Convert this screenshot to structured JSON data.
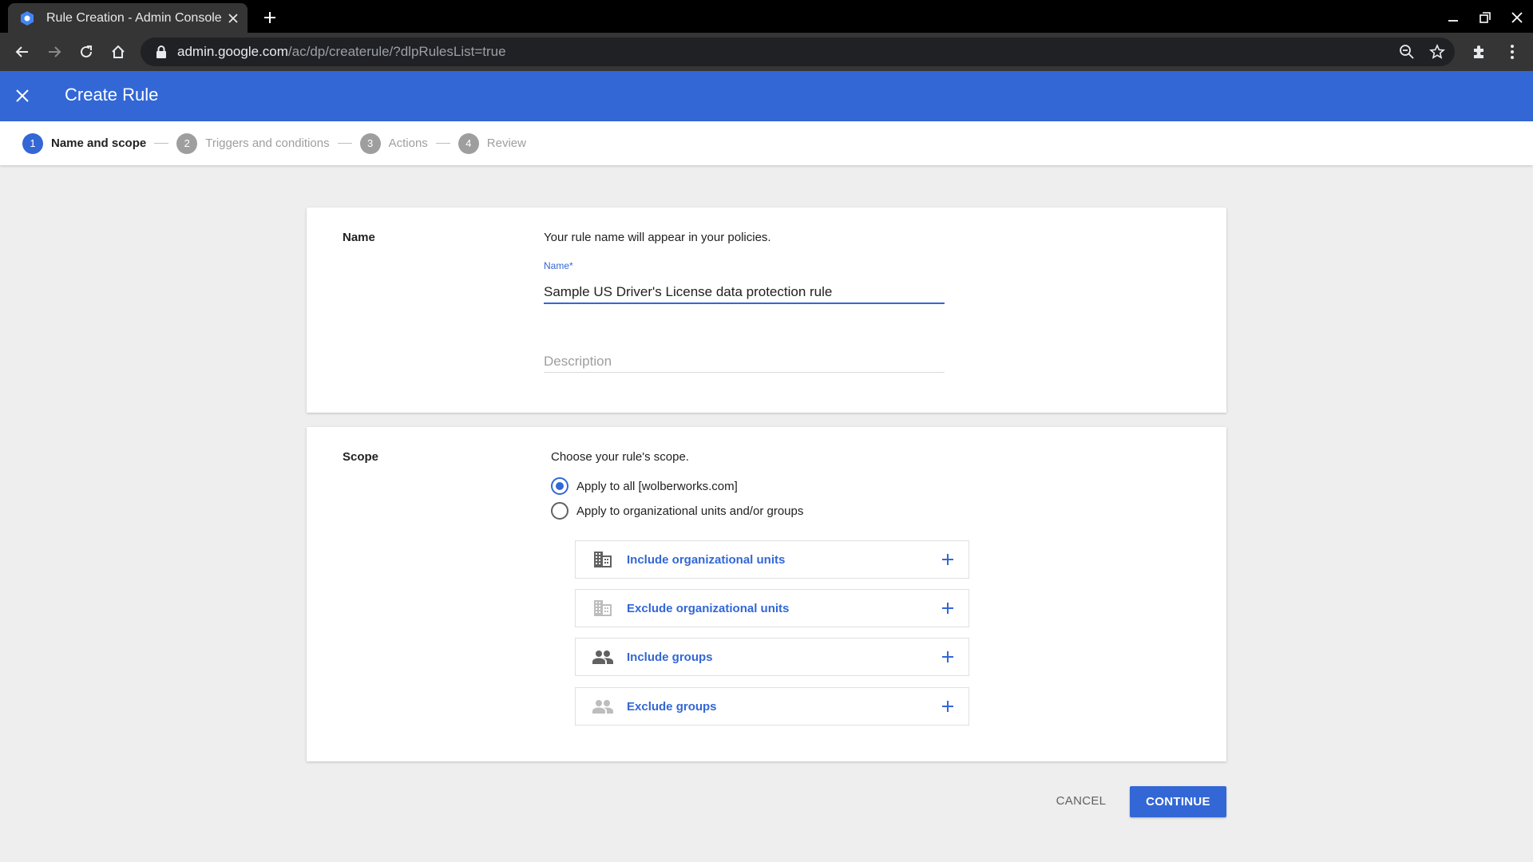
{
  "browser": {
    "tab_title": "Rule Creation - Admin Console",
    "url_host": "admin.google.com",
    "url_path": "/ac/dp/createrule/?dlpRulesList=true"
  },
  "header": {
    "title": "Create Rule"
  },
  "stepper": {
    "steps": [
      {
        "number": "1",
        "label": "Name and scope"
      },
      {
        "number": "2",
        "label": "Triggers and conditions"
      },
      {
        "number": "3",
        "label": "Actions"
      },
      {
        "number": "4",
        "label": "Review"
      }
    ]
  },
  "name_section": {
    "label": "Name",
    "help": "Your rule name will appear in your policies.",
    "name_field_label": "Name*",
    "name_value": "Sample US Driver's License data protection rule",
    "description_placeholder": "Description"
  },
  "scope_section": {
    "label": "Scope",
    "help": "Choose your rule's scope.",
    "options": [
      {
        "label": "Apply to all [wolberworks.com]",
        "checked": true
      },
      {
        "label": "Apply to organizational units and/or groups",
        "checked": false
      }
    ],
    "rows": [
      {
        "label": "Include organizational units",
        "icon": "building-icon"
      },
      {
        "label": "Exclude organizational units",
        "icon": "building-icon"
      },
      {
        "label": "Include groups",
        "icon": "group-icon"
      },
      {
        "label": "Exclude groups",
        "icon": "group-icon"
      }
    ]
  },
  "footer": {
    "cancel_label": "CANCEL",
    "continue_label": "CONTINUE"
  },
  "colors": {
    "accent": "#3367d6",
    "background": "#eeeeee"
  }
}
